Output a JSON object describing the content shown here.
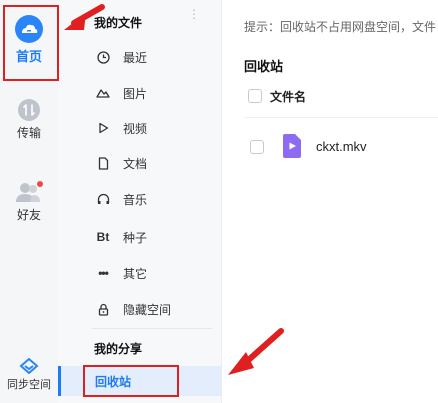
{
  "rail": {
    "home": "首页",
    "transfer": "传输",
    "friends": "好友",
    "sync": "同步空间"
  },
  "nav": {
    "my_files": "我的文件",
    "items": [
      "最近",
      "图片",
      "视频",
      "文档",
      "音乐",
      "种子",
      "其它",
      "隐藏空间"
    ],
    "torrent_icon_text": "Bt",
    "my_share": "我的分享",
    "recycle_bin": "回收站"
  },
  "main": {
    "hint": "提示：回收站不占用网盘空间，文件",
    "title": "回收站",
    "column_filename": "文件名",
    "files": [
      {
        "name": "ckxt.mkv"
      }
    ]
  },
  "colors": {
    "accent": "#1e7bf6",
    "annotation_red": "#e02020",
    "video_icon": "#8d6cf2",
    "badge": "#f0474b"
  }
}
